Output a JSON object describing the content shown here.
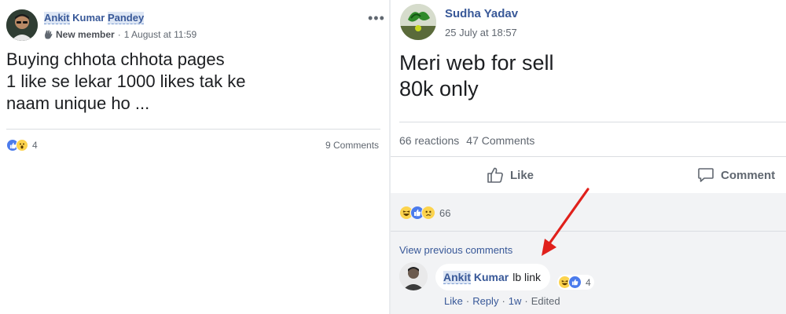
{
  "left_post": {
    "author_first": "Ankit",
    "author_middle": "Kumar",
    "author_last": "Pandey",
    "member_badge": "New member",
    "date_sep": "·",
    "date": "1 August at 11:59",
    "more_label": "•••",
    "body_lines": [
      "Buying chhota chhota pages",
      "1 like se lekar 1000 likes tak ke",
      "naam unique ho ..."
    ],
    "reaction_count": "4",
    "comments_label": "9 Comments"
  },
  "right_post": {
    "author": "Sudha Yadav",
    "date": "25 July at 18:57",
    "body_lines": [
      "Meri web for sell",
      "80k only"
    ],
    "reactions_label": "66 reactions",
    "comments_label": "47 Comments",
    "like_action": "Like",
    "comment_action": "Comment",
    "reaction_summary_count": "66",
    "view_previous": "View previous comments",
    "comment": {
      "author_first": "Ankit",
      "author_last": "Kumar",
      "text": "lb link",
      "reaction_count": "4",
      "like_link": "Like",
      "reply_link": "Reply",
      "age": "1w",
      "edited": "Edited",
      "sep": "·"
    }
  },
  "colors": {
    "link_blue": "#385898",
    "arrow_red": "#e0201b",
    "like_blue": "#4b7bec",
    "emoji_yellow": "#fcd34d"
  },
  "icons": [
    "wave-icon",
    "like-reaction-icon",
    "wow-reaction-icon",
    "haha-reaction-icon",
    "sad-reaction-icon",
    "thumbs-up-icon",
    "comment-icon",
    "red-arrow-annotation"
  ]
}
